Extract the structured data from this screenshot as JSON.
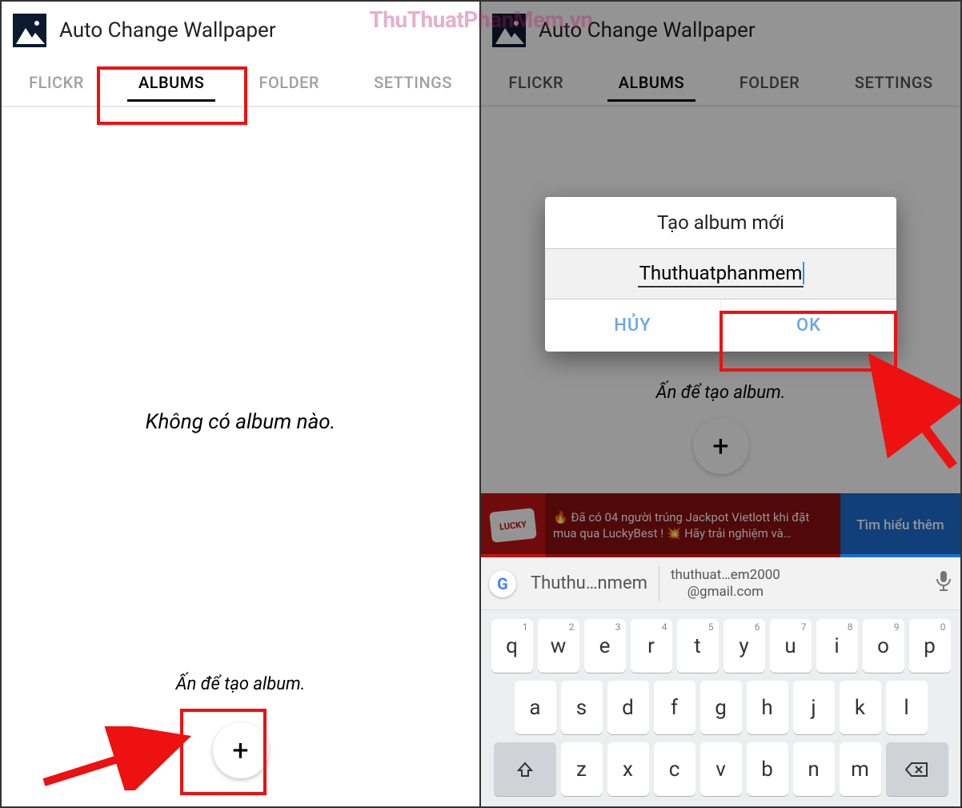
{
  "watermark": "ThuThuatPhanMem.vn",
  "app": {
    "title": "Auto Change Wallpaper"
  },
  "tabs": {
    "flickr": "FLICKR",
    "albums": "ALBUMS",
    "folder": "FOLDER",
    "settings": "SETTINGS",
    "active": "albums"
  },
  "left": {
    "no_album": "Không có album nào.",
    "press_to_create": "Ấn để tạo album."
  },
  "right": {
    "press_to_create": "Ấn để tạo album."
  },
  "dialog": {
    "title": "Tạo album mới",
    "input_value": "Thuthuatphanmem",
    "cancel": "HỦY",
    "ok": "OK"
  },
  "ad": {
    "icon_text": "LUCKY",
    "text": "🔥 Đã có 04 người trúng Jackpot Vietlott khi đặt mua qua LuckyBest ! 💥 Hãy trải nghiệm và…",
    "cta": "Tìm hiểu thêm"
  },
  "suggestions": {
    "s1": "Thuthu…nmem",
    "s2_line1": "thuthuat…em2000",
    "s2_line2": "@gmail.com"
  },
  "keyboard": {
    "row1": [
      {
        "l": "q",
        "n": "1"
      },
      {
        "l": "w",
        "n": "2"
      },
      {
        "l": "e",
        "n": "3"
      },
      {
        "l": "r",
        "n": "4"
      },
      {
        "l": "t",
        "n": "5"
      },
      {
        "l": "y",
        "n": "6"
      },
      {
        "l": "u",
        "n": "7"
      },
      {
        "l": "i",
        "n": "8"
      },
      {
        "l": "o",
        "n": "9"
      },
      {
        "l": "p",
        "n": "0"
      }
    ],
    "row2": [
      {
        "l": "a"
      },
      {
        "l": "s"
      },
      {
        "l": "d"
      },
      {
        "l": "f"
      },
      {
        "l": "g"
      },
      {
        "l": "h"
      },
      {
        "l": "j"
      },
      {
        "l": "k"
      },
      {
        "l": "l"
      }
    ],
    "row3_mid": [
      {
        "l": "z"
      },
      {
        "l": "x"
      },
      {
        "l": "c"
      },
      {
        "l": "v"
      },
      {
        "l": "b"
      },
      {
        "l": "n"
      },
      {
        "l": "m"
      }
    ]
  }
}
